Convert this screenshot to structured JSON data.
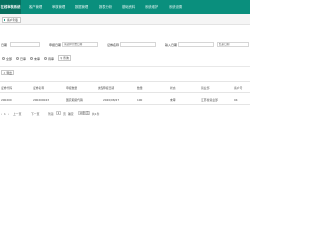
{
  "header": {
    "brand": "在线审核系统",
    "nav": [
      "客户管理",
      "审核管理",
      "数据管理",
      "报表分析",
      "基础资料",
      "系统维护",
      "系统设置"
    ]
  },
  "breadcrumb": {
    "label": "客户列表"
  },
  "filters": {
    "row1": {
      "label_a": "日期",
      "value_a": "",
      "label_b": "申报日期",
      "value_b": "请选择开始日期",
      "label_c": "证券名称",
      "value_c": "",
      "label_d": "输入日期",
      "value_d": "",
      "label_e": "",
      "value_e": "结束日期"
    },
    "radios": [
      "全部",
      "已审",
      "未审",
      "待审"
    ],
    "search_label": "查询"
  },
  "toolbar": {
    "export_label": "导出"
  },
  "table": {
    "columns": [
      "证券代码",
      "证券名称",
      "申报数量",
      "类型",
      "申报日期",
      "数量",
      "状态",
      "营业部",
      "客户号"
    ],
    "rows": [
      [
        "200200",
        "200200023",
        "国农期货代销",
        "",
        "2020/08/27",
        "100",
        "未审",
        "江苏省营业部",
        "04"
      ]
    ]
  },
  "pager": {
    "prev": "上一页",
    "page": "1",
    "next": "下一页",
    "go_prefix": "到第",
    "go_suffix": "页",
    "confirm": "确定",
    "total": "共1条",
    "size": "10条/页"
  },
  "colors": {
    "topbar": "#0a8f7d",
    "brand_bg": "#06705f"
  }
}
